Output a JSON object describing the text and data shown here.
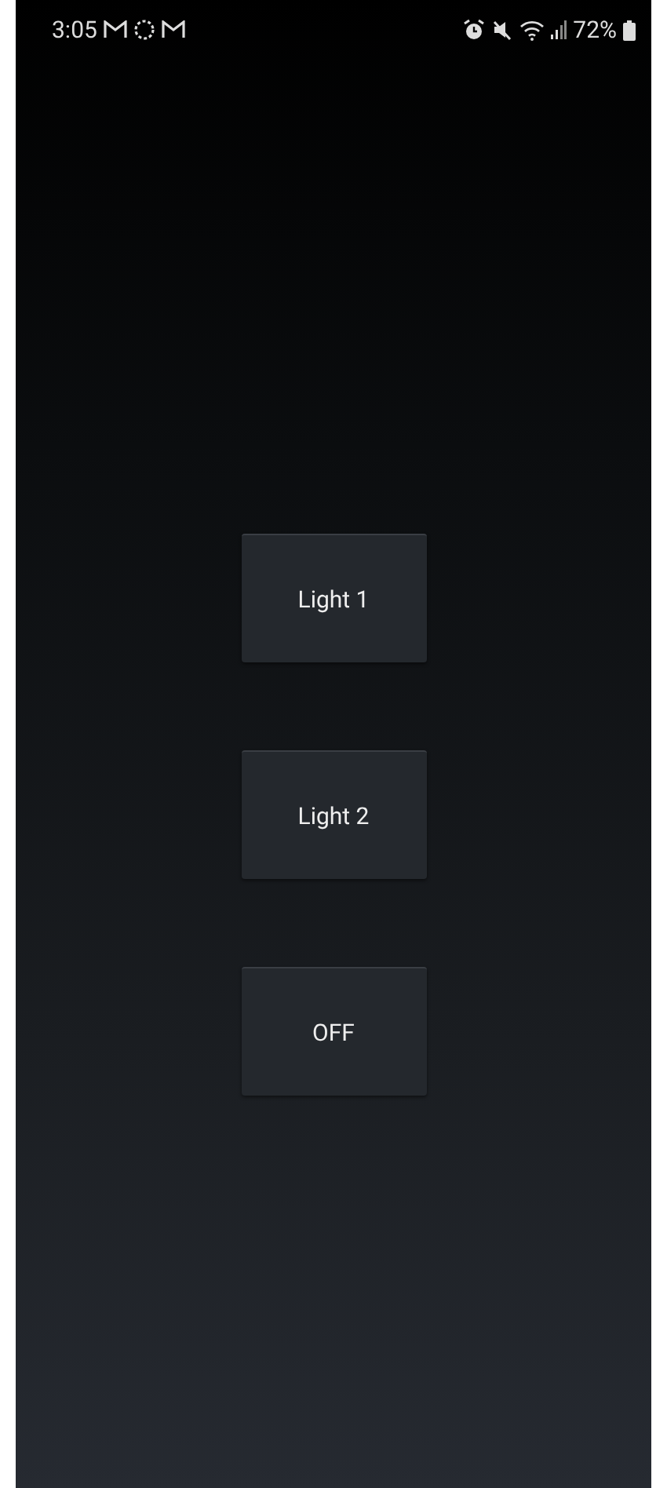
{
  "status_bar": {
    "time": "3:05",
    "battery": "72%"
  },
  "buttons": [
    {
      "label": "Light 1"
    },
    {
      "label": "Light 2"
    },
    {
      "label": "OFF"
    }
  ]
}
